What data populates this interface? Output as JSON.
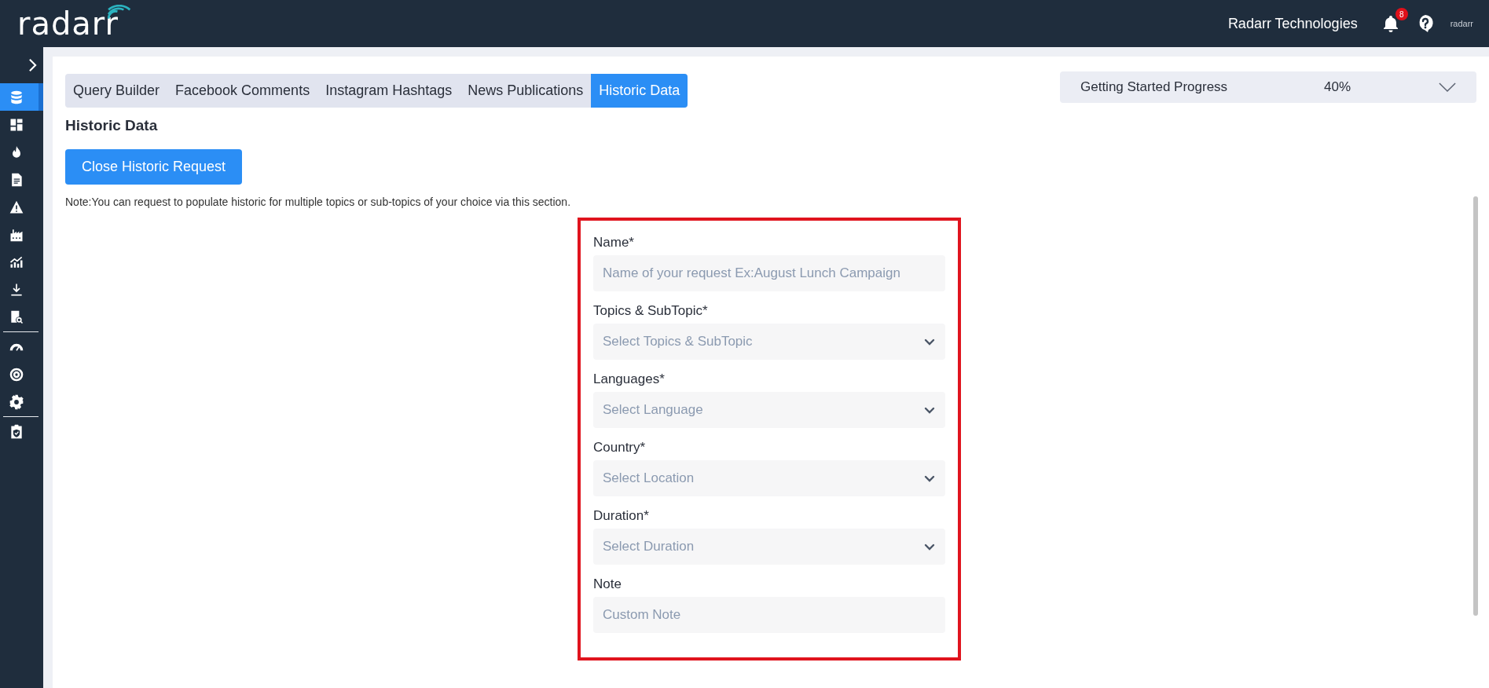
{
  "header": {
    "logo": "radarr",
    "company": "Radarr Technologies",
    "notifications": "8",
    "small_logo": "radarr"
  },
  "sidebar": {
    "sections": [
      {
        "items": [
          {
            "selected": true
          },
          {
            "selected": false
          },
          {
            "selected": false
          },
          {
            "selected": false
          },
          {
            "selected": false
          },
          {
            "selected": false
          },
          {
            "selected": false
          },
          {
            "selected": false
          },
          {
            "selected": false
          }
        ]
      },
      {
        "items": [
          {
            "selected": false
          },
          {
            "selected": false
          },
          {
            "selected": false
          }
        ]
      },
      {
        "items": [
          {
            "selected": false
          }
        ]
      }
    ]
  },
  "tabs": [
    {
      "label": "Query Builder",
      "selected": false
    },
    {
      "label": "Facebook Comments",
      "selected": false
    },
    {
      "label": "Instagram Hashtags",
      "selected": false
    },
    {
      "label": "News Publications",
      "selected": false
    },
    {
      "label": "Historic Data",
      "selected": true
    }
  ],
  "progress": {
    "label": "Getting Started Progress",
    "value": "40%"
  },
  "page": {
    "title": "Historic Data",
    "button": "Close Historic Request",
    "note": "Note:You can request to populate historic for multiple topics or sub-topics of your choice via this section."
  },
  "form": {
    "fields": [
      {
        "kind": "text",
        "label": "Name*",
        "placeholder": "Name of your request Ex:August Lunch Campaign"
      },
      {
        "kind": "select",
        "label": "Topics & SubTopic*",
        "placeholder": "Select Topics & SubTopic"
      },
      {
        "kind": "select",
        "label": "Languages*",
        "placeholder": "Select Language"
      },
      {
        "kind": "select",
        "label": "Country*",
        "placeholder": "Select Location"
      },
      {
        "kind": "select",
        "label": "Duration*",
        "placeholder": "Select Duration"
      },
      {
        "kind": "text",
        "label": "Note",
        "placeholder": "Custom Note"
      }
    ]
  }
}
